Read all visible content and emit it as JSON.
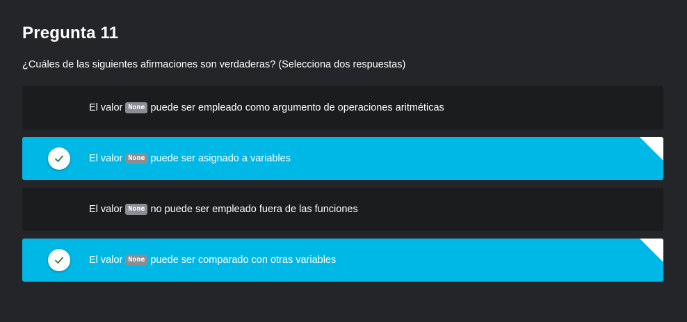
{
  "question": {
    "title": "Pregunta 11",
    "prompt": "¿Cuáles de las siguientes afirmaciones son verdaderas? (Selecciona dos respuestas)"
  },
  "options": [
    {
      "prefix": "El valor",
      "code": "None",
      "suffix": "puede ser empleado como argumento de operaciones aritméticas",
      "selected": false
    },
    {
      "prefix": "El valor",
      "code": "None",
      "suffix": "puede ser asignado a variables",
      "selected": true
    },
    {
      "prefix": "El valor",
      "code": "None",
      "suffix": "no puede ser empleado fuera de las funciones",
      "selected": false
    },
    {
      "prefix": "El valor",
      "code": "None",
      "suffix": "puede ser comparado con otras variables",
      "selected": true
    }
  ],
  "icons": {
    "check": "check-icon",
    "corner": "corner-fold-icon"
  },
  "colors": {
    "background": "#242528",
    "option_background": "#1b1c1e",
    "selected_background": "#00b8e6",
    "check_color": "#2e7d32",
    "code_badge": "#8a8d92"
  }
}
